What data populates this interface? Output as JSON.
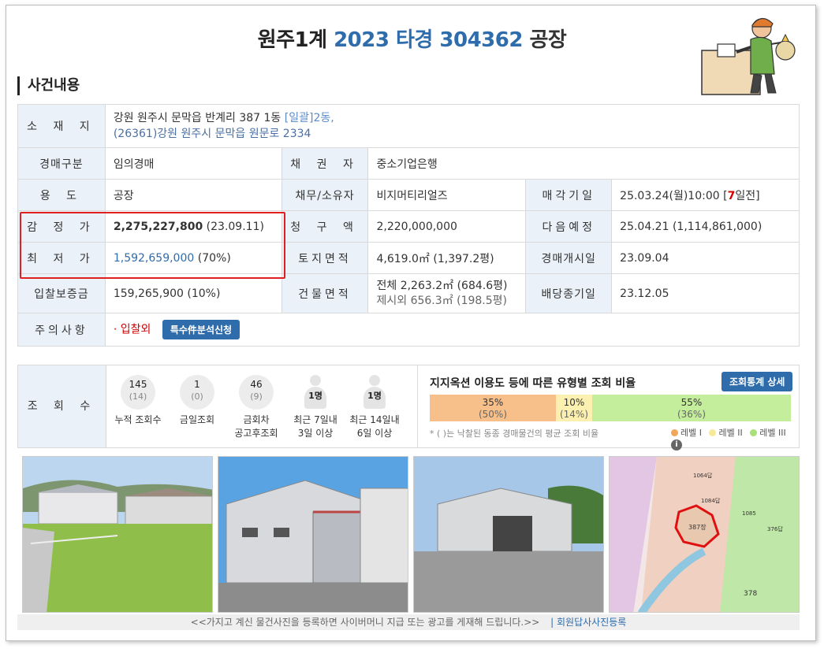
{
  "header": {
    "court": "원주1계",
    "case_no": "2023 타경 304362",
    "category": "공장"
  },
  "section_title": "사건내용",
  "labels": {
    "address": "소 재 지",
    "auction_type": "경매구분",
    "usage": "용 도",
    "appraisal": "감 정 가",
    "min_price": "최 저 가",
    "deposit": "입찰보증금",
    "notes": "주의사항",
    "creditor": "채 권 자",
    "debtor": "채무/소유자",
    "claim": "청 구 액",
    "land_area": "토지면적",
    "building_area": "건물면적",
    "sale_date": "매각기일",
    "next_schedule": "다음예정",
    "start_date": "경매개시일",
    "dividend_end": "배당종기일",
    "views": "조 회 수"
  },
  "values": {
    "address_line1": "강원 원주시 문막읍 반계리 387 1동",
    "address_tag": "[일괄]",
    "address_tag_tail": "2동,",
    "address_line2": "(26361)강원 원주시  문막읍 원문로  2334",
    "auction_type": "임의경매",
    "usage": "공장",
    "appraisal": "2,275,227,800",
    "appraisal_date": "(23.09.11)",
    "min_price": "1,592,659,000",
    "min_ratio": "(70%)",
    "deposit": "159,265,900 (10%)",
    "notes": "· 입찰외",
    "notes_button": "특수件분석신청",
    "creditor": "중소기업은행",
    "debtor": "비지머티리얼즈",
    "claim": "2,220,000,000",
    "land_area": "4,619.0㎡ (1,397.2평)",
    "building_area_total": "전체 2,263.2㎡ (684.6평)",
    "building_area_excl": "제시외 656.3㎡ (198.5평)",
    "sale_date_main": "25.03.24(월)10:00 [",
    "sale_date_days": "7",
    "sale_date_tail": "일전]",
    "next_schedule": "25.04.21 (1,114,861,000)",
    "start_date": "23.09.04",
    "dividend_end": "23.12.05"
  },
  "view_counts": [
    {
      "num": "145",
      "sub": "(14)",
      "label": "누적 조회수",
      "label2": ""
    },
    {
      "num": "1",
      "sub": "(0)",
      "label": "금일조회",
      "label2": ""
    },
    {
      "num": "46",
      "sub": "(9)",
      "label": "금회차",
      "label2": "공고후조회"
    }
  ],
  "recent_views": [
    {
      "num": "1명",
      "label": "최근 7일내",
      "label2": "3일 이상"
    },
    {
      "num": "1명",
      "label": "최근 14일내",
      "label2": "6일 이상"
    }
  ],
  "ratio": {
    "title": "지지옥션 이용도 등에 따른 유형별 조회 비율",
    "button": "조회통계 상세",
    "bars": [
      {
        "pct": "35%",
        "avg": "(50%)",
        "color": "#f7c08a",
        "frac": 0.35
      },
      {
        "pct": "10%",
        "avg": "(14%)",
        "color": "#fbf0b0",
        "frac": 0.1
      },
      {
        "pct": "55%",
        "avg": "(36%)",
        "color": "#c4ee9c",
        "frac": 0.55
      }
    ],
    "note": "* ( )는 낙찰된 동종 경매물건의 평균 조회 비율",
    "legend": [
      {
        "label": "레벨 I",
        "color": "#f3a55a"
      },
      {
        "label": "레벨 II",
        "color": "#f6ea9a"
      },
      {
        "label": "레벨 III",
        "color": "#a8e07a"
      }
    ]
  },
  "map_labels": [
    "387장",
    "1064답",
    "1084답",
    "1085",
    "376답",
    "378"
  ],
  "footer": {
    "text": "<<가지고 계신 물건사진을 등록하면 사이버머니 지급 또는 광고를 게재해 드립니다.>>",
    "link": "| 회원답사사진등록"
  }
}
